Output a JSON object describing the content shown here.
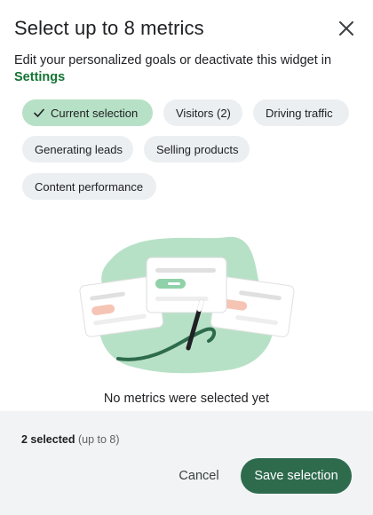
{
  "dialog": {
    "title": "Select up to 8 metrics",
    "close_icon": "close-icon",
    "subtitle": "Edit your personalized goals or deactivate this widget in",
    "settings_link": "Settings"
  },
  "chips": [
    {
      "label": "Current selection",
      "selected": true,
      "icon": "check-icon"
    },
    {
      "label": "Visitors (2)",
      "selected": false
    },
    {
      "label": "Driving traffic",
      "selected": false
    },
    {
      "label": "Generating leads",
      "selected": false
    },
    {
      "label": "Selling products",
      "selected": false
    },
    {
      "label": "Content performance",
      "selected": false
    }
  ],
  "empty_state": {
    "message": "No metrics were selected yet",
    "illustration": "cards-with-magic-wand"
  },
  "footer": {
    "count_selected": "2 selected",
    "count_limit": "(up to 8)",
    "cancel_label": "Cancel",
    "save_label": "Save selection"
  },
  "colors": {
    "accent": "#137333",
    "primary_button": "#2e6b4d",
    "chip_selected": "#b7e1c6",
    "chip_default": "#eceff1",
    "footer_bg": "#f1f3f4"
  }
}
